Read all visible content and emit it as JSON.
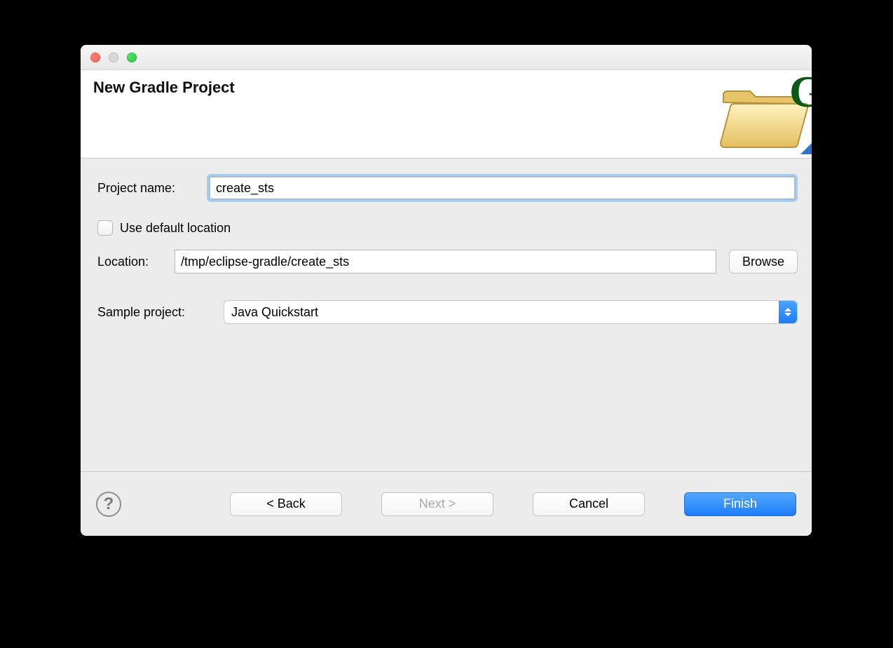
{
  "header": {
    "title": "New Gradle Project"
  },
  "form": {
    "project_label": "Project name:",
    "project_value": "create_sts",
    "use_default_label": "Use default location",
    "use_default_checked": false,
    "location_label": "Location:",
    "location_value": "/tmp/eclipse-gradle/create_sts",
    "browse_label": "Browse",
    "sample_label": "Sample project:",
    "sample_value": "Java Quickstart"
  },
  "buttons": {
    "back": "< Back",
    "next": "Next >",
    "cancel": "Cancel",
    "finish": "Finish"
  }
}
